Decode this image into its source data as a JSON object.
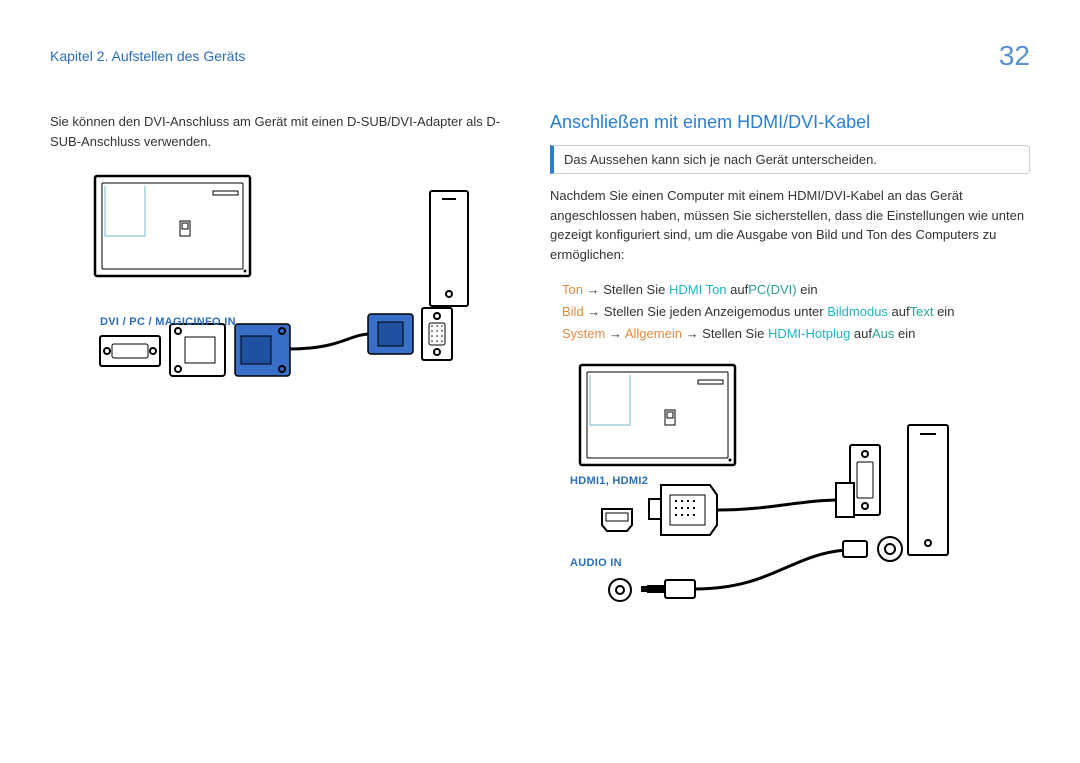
{
  "header": {
    "chapter": "Kapitel 2. Aufstellen des Geräts",
    "page": "32"
  },
  "left": {
    "intro": "Sie können den DVI-Anschluss am Gerät mit einen D-SUB/DVI-Adapter als D-SUB-Anschluss verwenden.",
    "port_label": "DVI / PC / MAGICINFO IN"
  },
  "right": {
    "heading": "Anschließen mit einem HDMI/DVI-Kabel",
    "note": "Das Aussehen kann sich je nach Gerät unterscheiden.",
    "body": "Nachdem Sie einen Computer mit einem HDMI/DVI-Kabel an das Gerät angeschlossen haben, müssen Sie sicherstellen, dass die Einstellungen wie unten gezeigt konfiguriert sind, um die Ausgabe von Bild und Ton des Computers zu ermöglichen:",
    "setting1": {
      "a": "Ton",
      "sep1": " → Stellen Sie ",
      "b": "HDMI Ton",
      "sep2": " auf",
      "c": "PC(DVI)",
      "sep3": "  ein"
    },
    "setting2": {
      "a": "Bild",
      "sep1": " → Stellen Sie jeden Anzeigemodus unter ",
      "b": "Bildmodus",
      "sep2": "  auf",
      "c": "Text",
      "sep3": "  ein"
    },
    "setting3": {
      "a": "System",
      "sep1": " → ",
      "b": "Allgemein",
      "sep2": " → Stellen Sie ",
      "c": "HDMI-Hotplug",
      "sep3": "  auf",
      "d": "Aus",
      "sep4": "  ein"
    },
    "labels": {
      "hdmi": "HDMI1, HDMI2",
      "audio": "AUDIO IN"
    }
  }
}
